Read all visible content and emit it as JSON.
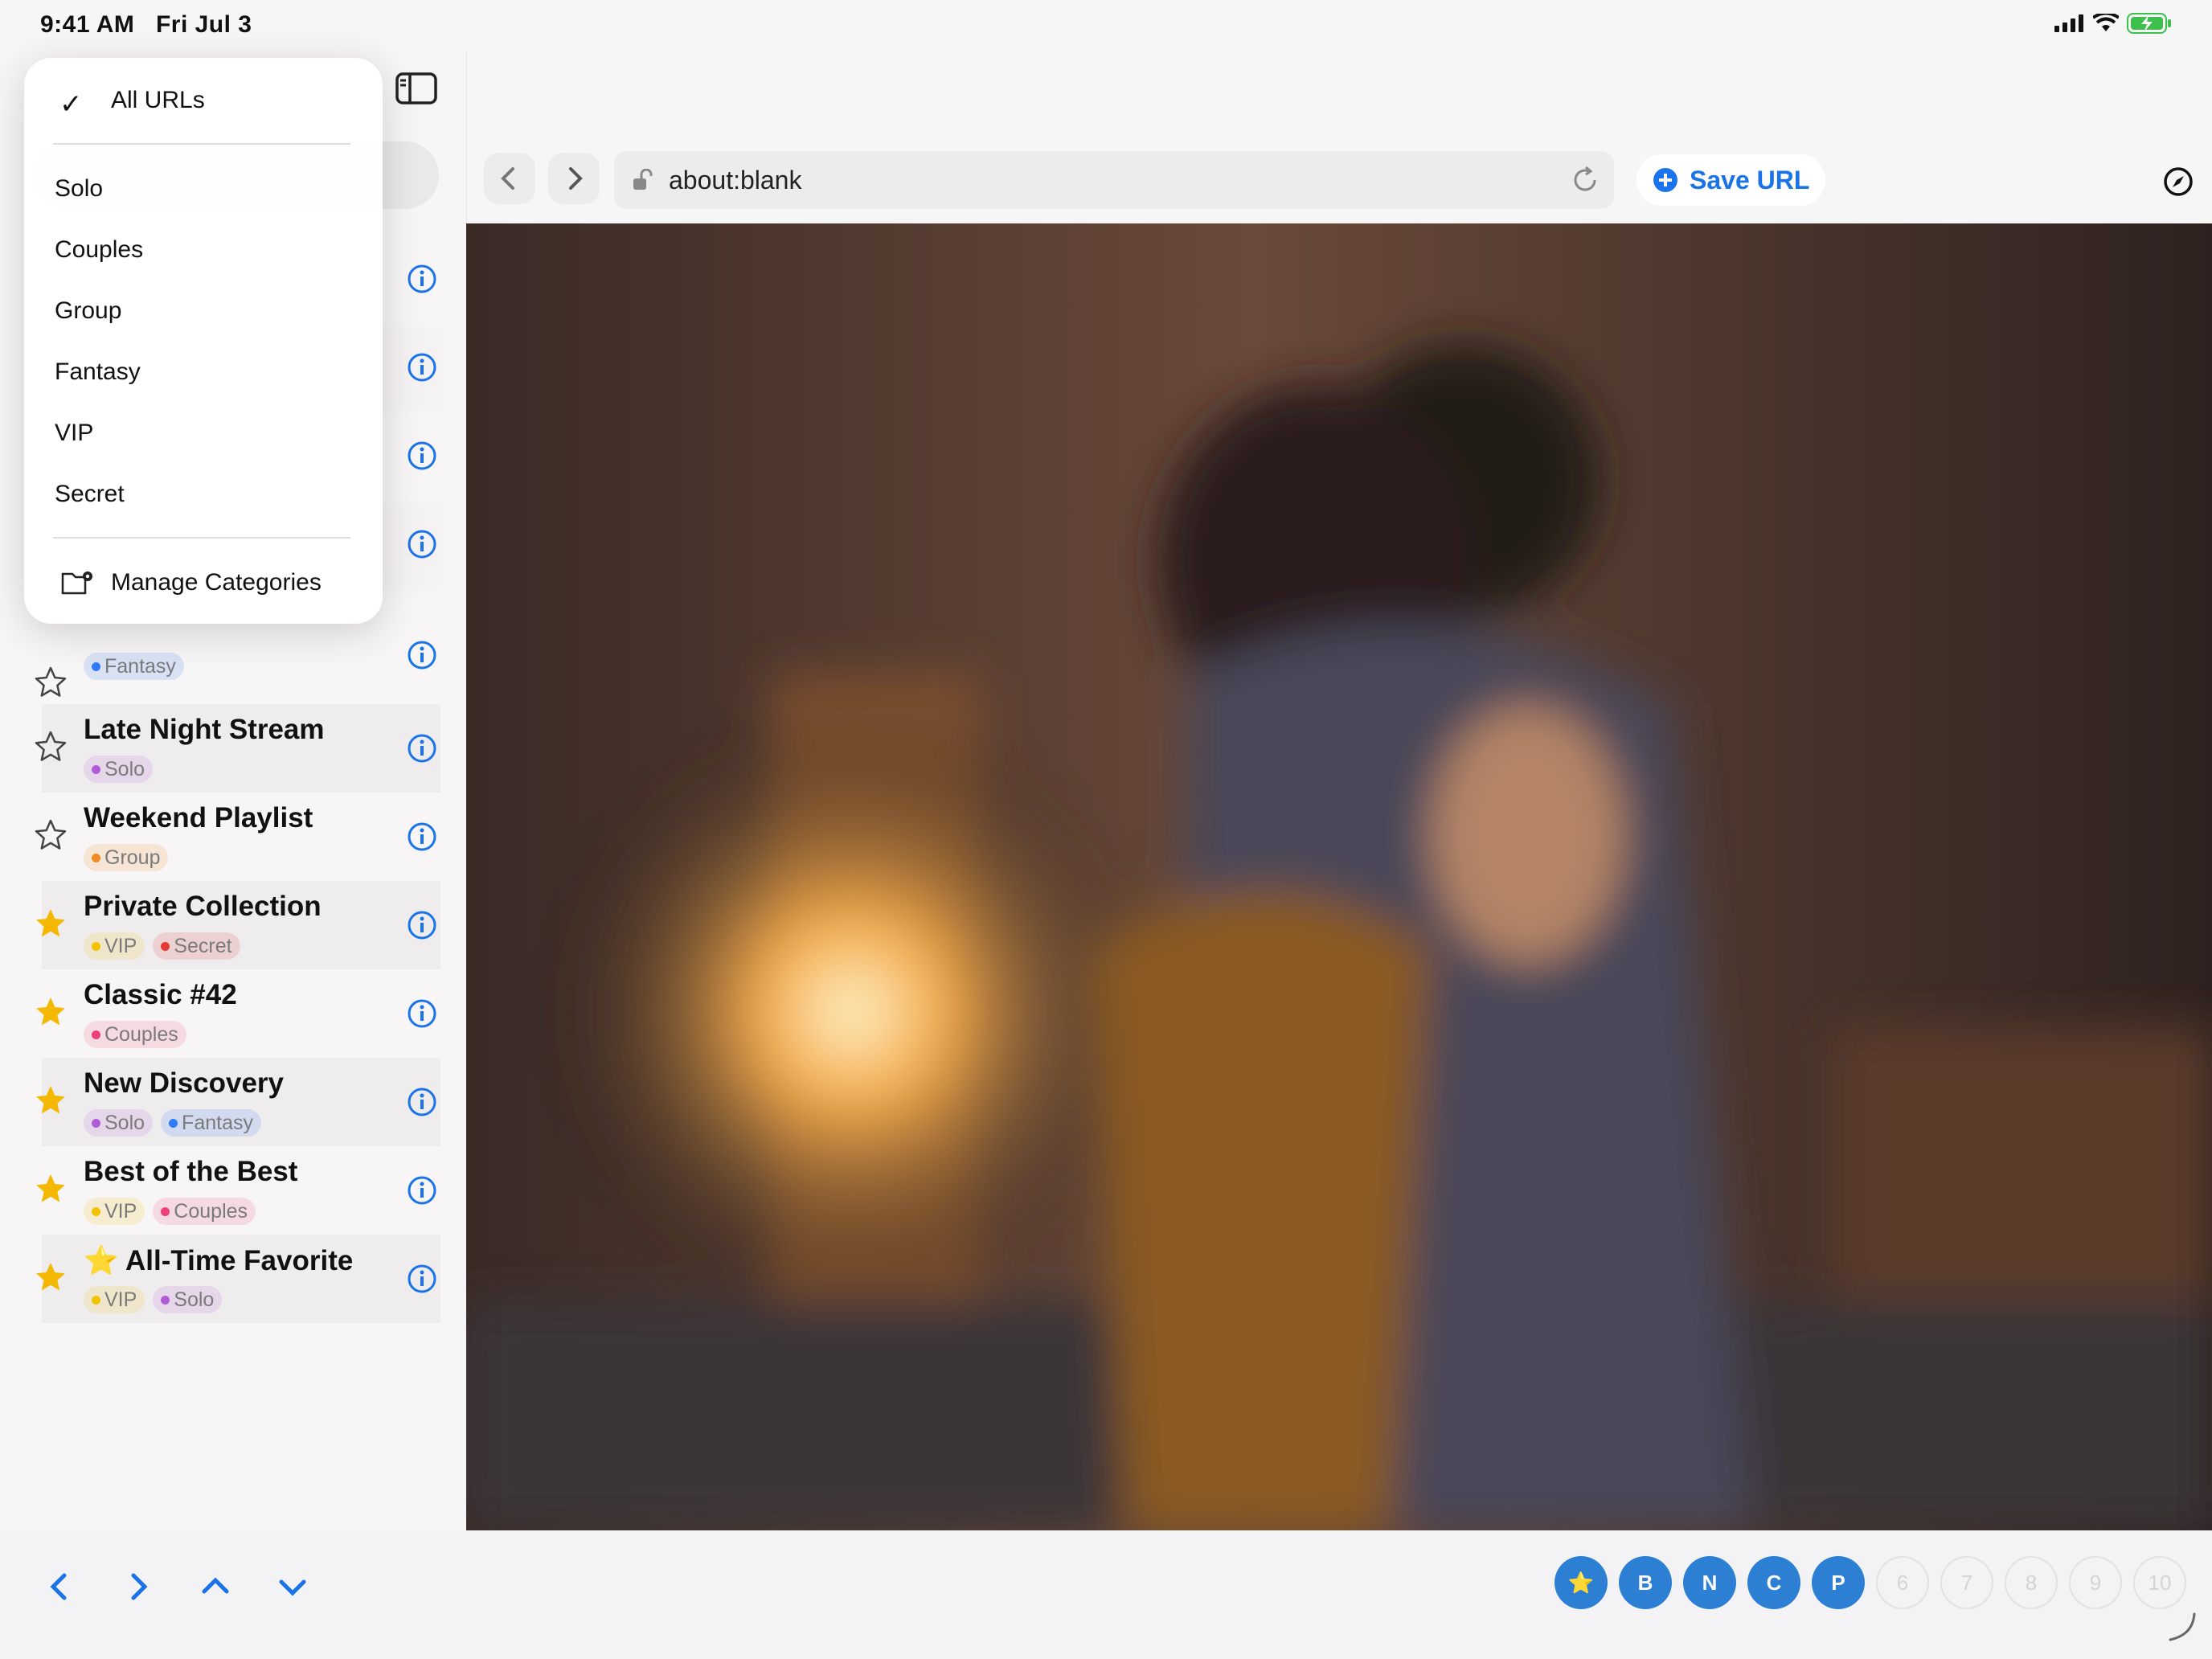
{
  "status_bar": {
    "time": "9:41 AM",
    "date": "Fri Jul 3",
    "icons": [
      "cellular-signal-icon",
      "wifi-icon",
      "battery-charging-icon"
    ]
  },
  "menu": {
    "selected": "All URLs",
    "items": [
      "Solo",
      "Couples",
      "Group",
      "Fantasy",
      "VIP",
      "Secret"
    ],
    "manage_label": "Manage Categories"
  },
  "list": {
    "visible_items": [
      {
        "title": "",
        "favorite": false,
        "tags": [
          {
            "label": "Fantasy",
            "color": "#2f7cf6"
          }
        ]
      },
      {
        "title": "Late Night Stream",
        "favorite": false,
        "tags": [
          {
            "label": "Solo",
            "color": "#b05cd6"
          }
        ]
      },
      {
        "title": "Weekend Playlist",
        "favorite": false,
        "tags": [
          {
            "label": "Group",
            "color": "#f08a24"
          }
        ]
      },
      {
        "title": "Private Collection",
        "favorite": true,
        "tags": [
          {
            "label": "VIP",
            "color": "#f2c200"
          },
          {
            "label": "Secret",
            "color": "#e53935"
          }
        ]
      },
      {
        "title": "Classic #42",
        "favorite": true,
        "tags": [
          {
            "label": "Couples",
            "color": "#ec407a"
          }
        ]
      },
      {
        "title": "New Discovery",
        "favorite": true,
        "tags": [
          {
            "label": "Solo",
            "color": "#b05cd6"
          },
          {
            "label": "Fantasy",
            "color": "#2f7cf6"
          }
        ]
      },
      {
        "title": "Best of the Best",
        "favorite": true,
        "tags": [
          {
            "label": "VIP",
            "color": "#f2c200"
          },
          {
            "label": "Couples",
            "color": "#ec407a"
          }
        ]
      },
      {
        "title": "⭐ All-Time Favorite",
        "favorite": true,
        "tags": [
          {
            "label": "VIP",
            "color": "#f2c200"
          },
          {
            "label": "Solo",
            "color": "#b05cd6"
          }
        ]
      }
    ]
  },
  "toolbar": {
    "url": "about:blank",
    "save_label": "Save URL"
  },
  "bottom_bar": {
    "active_buttons": [
      "⭐",
      "B",
      "N",
      "C",
      "P"
    ],
    "inactive_buttons": [
      "6",
      "7",
      "8",
      "9",
      "10"
    ]
  },
  "colors": {
    "accent": "#1a73e8",
    "favorite_star": "#f5b800",
    "shortcut_active": "#2d7fd3"
  }
}
